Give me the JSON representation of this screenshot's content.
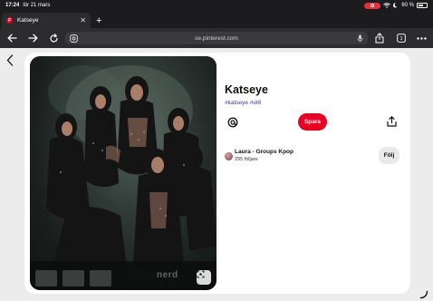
{
  "statusbar": {
    "time": "17:24",
    "date": "lör 21 mars",
    "battery": "60 %",
    "battery_level": 0.6
  },
  "browser": {
    "tab_title": "Katseye",
    "url": "se.pinterest.com"
  },
  "pin": {
    "title": "Katseye",
    "hashtags": "#katseye #ot6",
    "save_label": "Spara",
    "watermark": "nerd"
  },
  "creator": {
    "name": "Laura - Groups Kpop",
    "followers": "295 följare",
    "follow_label": "Följ"
  },
  "colors": {
    "brand": "#e60023",
    "chrome": "#2c2c2e",
    "link": "#3b3b9b"
  }
}
